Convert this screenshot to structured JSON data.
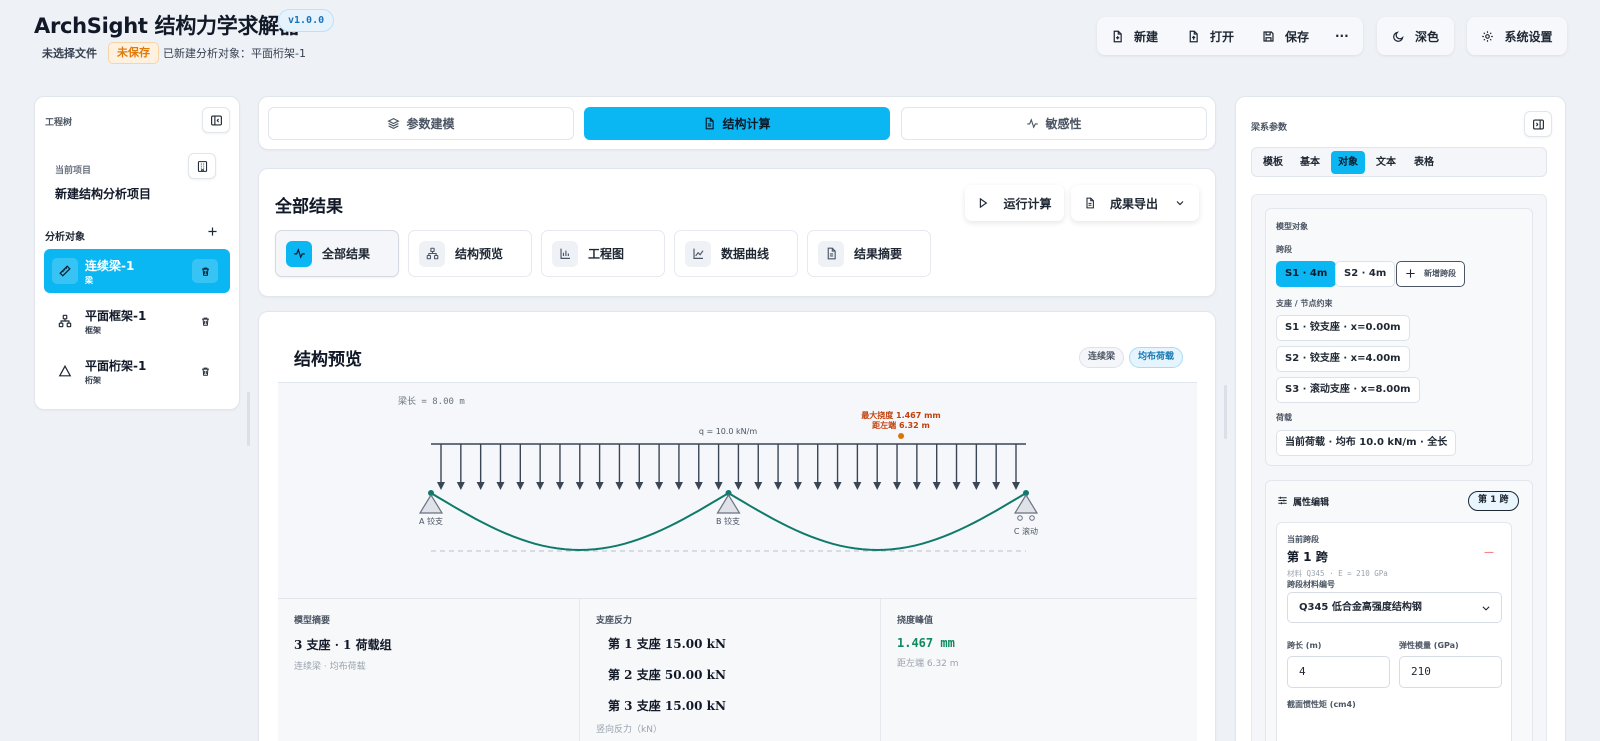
{
  "app": {
    "title": "ArchSight 结构力学求解器",
    "version": "v1.0.0",
    "file_status": "未选择文件",
    "unsaved": "未保存",
    "created_object": "已新建分析对象：平面桁架-1"
  },
  "toolbar": {
    "new_label": "新建",
    "open_label": "打开",
    "save_label": "保存",
    "more_label": "···",
    "dark_label": "深色",
    "settings_label": "系统设置"
  },
  "left_panel": {
    "title": "工程树",
    "project_label": "当前项目",
    "project_name": "新建结构分析项目",
    "analysis_label": "分析对象",
    "objects": [
      {
        "name": "连续梁-1",
        "type": "梁",
        "icon": "ruler-icon",
        "active": true
      },
      {
        "name": "平面框架-1",
        "type": "框架",
        "icon": "network-icon",
        "active": false
      },
      {
        "name": "平面桁架-1",
        "type": "桁架",
        "icon": "triangle-icon",
        "active": false
      }
    ]
  },
  "main_tabs": [
    {
      "label": "参数建模",
      "icon": "layers-icon",
      "active": false
    },
    {
      "label": "结构计算",
      "icon": "document-icon",
      "active": true
    },
    {
      "label": "敏感性",
      "icon": "pulse-icon",
      "active": false
    }
  ],
  "results": {
    "title": "全部结果",
    "run_label": "运行计算",
    "export_label": "成果导出",
    "sub_tabs": [
      {
        "label": "全部结果",
        "icon": "pulse-icon",
        "active": true
      },
      {
        "label": "结构预览",
        "icon": "network-icon",
        "active": false
      },
      {
        "label": "工程图",
        "icon": "bar-chart-icon",
        "active": false
      },
      {
        "label": "数据曲线",
        "icon": "line-chart-icon",
        "active": false
      },
      {
        "label": "结果摘要",
        "icon": "document-icon",
        "active": false
      }
    ]
  },
  "preview": {
    "title": "结构预览",
    "tags": [
      "连续梁",
      "均布荷载"
    ],
    "diagram": {
      "beam_length_label": "梁长 = 8.00 m",
      "load_label": "q = 10.0 kN/m",
      "max_deflection_label": "最大挠度 1.467 mm",
      "max_deflection_pos_label": "距左端 6.32 m",
      "support_labels": [
        "A 铰支",
        "B 铰支",
        "C 滚动"
      ],
      "beam_length_m": 8.0,
      "support_positions_m": [
        0,
        4,
        8
      ],
      "load_kN_per_m": 10.0,
      "load_arrow_count": 30,
      "max_deflection_mm": 1.467,
      "max_deflection_pos_m": 6.32,
      "colors": {
        "beam": "#3a4655",
        "deflection": "#0f7a6a",
        "marker": "#d97706",
        "support": "#6b7280"
      }
    },
    "summary": {
      "model_label": "模型摘要",
      "model_value": "3 支座 · 1 荷载组",
      "model_sub": "连续梁 · 均布荷载",
      "reaction_label": "支座反力",
      "reactions": [
        "第 1 支座 15.00 kN",
        "第 2 支座 50.00 kN",
        "第 3 支座 15.00 kN"
      ],
      "reaction_sub": "竖向反力（kN）",
      "deflection_label": "挠度峰值",
      "deflection_value": "1.467 mm",
      "deflection_sub": "距左端 6.32 m"
    }
  },
  "right_panel": {
    "title": "梁系参数",
    "tabs": [
      {
        "label": "模板",
        "active": false
      },
      {
        "label": "基本",
        "active": false
      },
      {
        "label": "对象",
        "active": true
      },
      {
        "label": "文本",
        "active": false
      },
      {
        "label": "表格",
        "active": false
      }
    ],
    "model_card_title": "模型对象",
    "spans_label": "跨段",
    "spans": [
      {
        "label": "S1 · 4m",
        "active": true
      },
      {
        "label": "S2 · 4m",
        "active": false
      }
    ],
    "add_span_label": "新增跨段",
    "supports_label": "支座 / 节点约束",
    "supports": [
      "S1 · 铰支座 · x=0.00m",
      "S2 · 铰支座 · x=4.00m",
      "S3 · 滚动支座 · x=8.00m"
    ],
    "loads_label": "荷载",
    "load_item": "当前荷载 · 均布 10.0 kN/m · 全长",
    "prop_title": "属性编辑",
    "span_pill": "第 1 跨",
    "current_span_label": "当前跨段",
    "current_span_value": "第 1 跨",
    "remove_mark": "—",
    "material_sub": "材料 Q345 · E = 210 GPa",
    "material_code_label": "跨段材料编号",
    "material_select": "Q345 低合金高强度结构钢",
    "length_label": "跨长 (m)",
    "length_value": "4",
    "modulus_label": "弹性模量 (GPa)",
    "modulus_value": "210",
    "inertia_label": "截面惯性矩 (cm4)"
  }
}
